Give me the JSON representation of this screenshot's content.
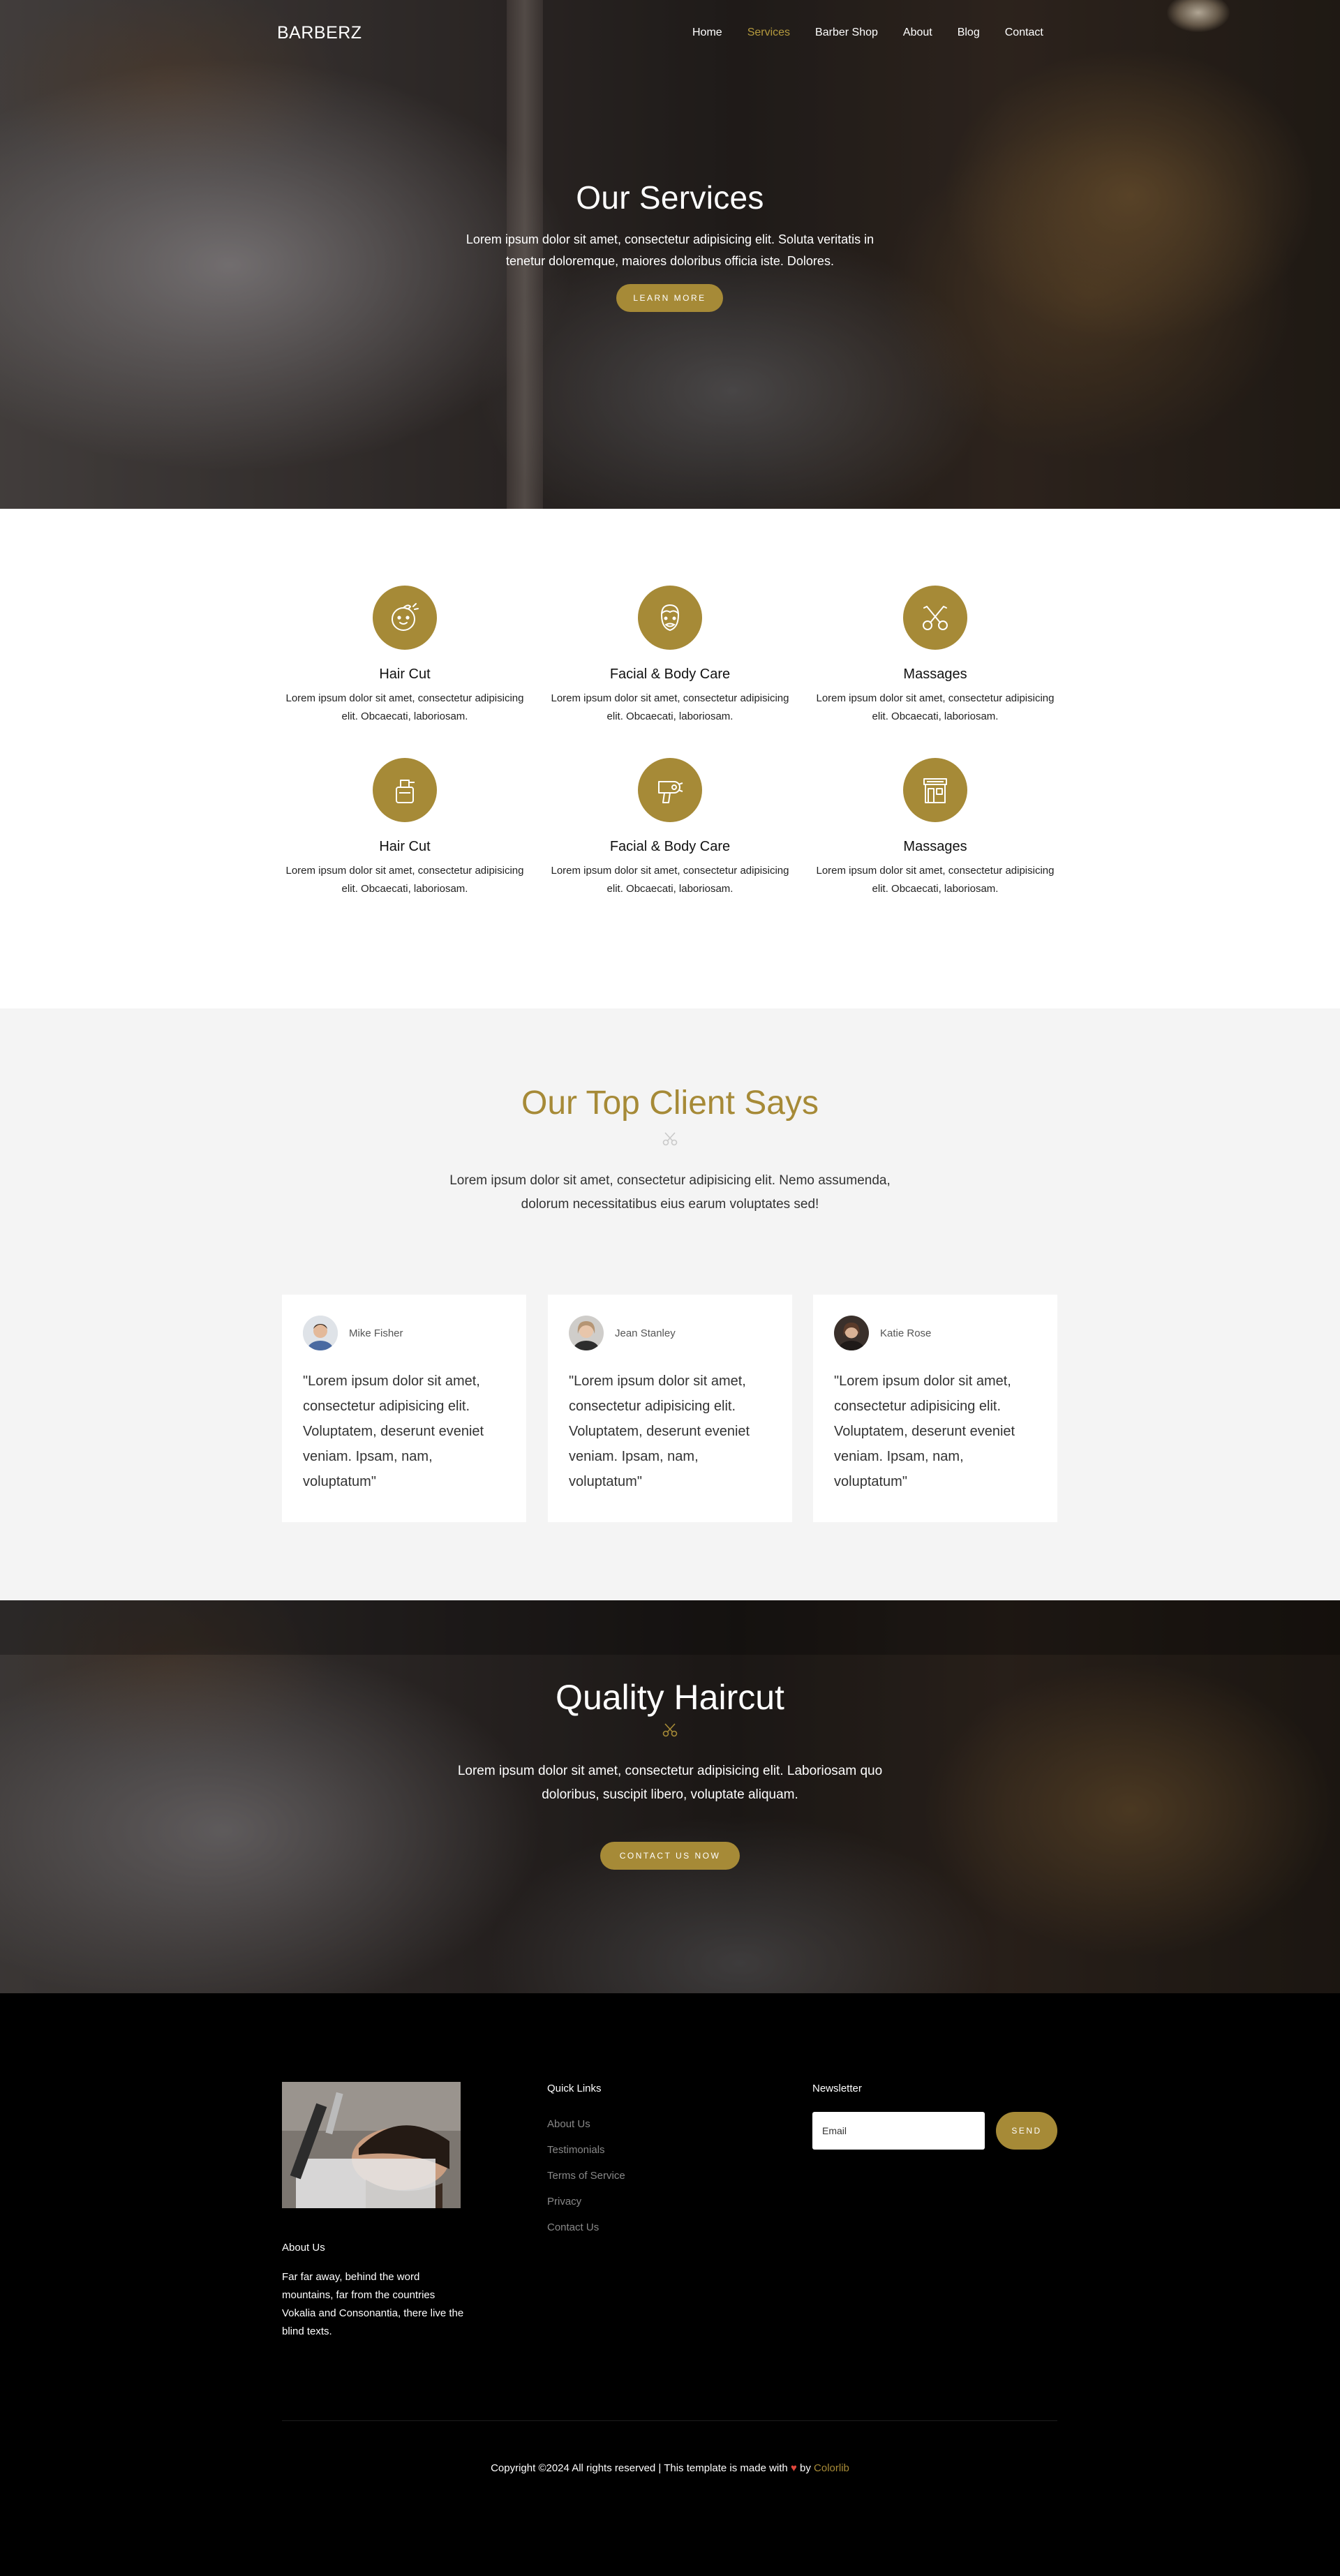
{
  "nav": {
    "brand": "BARBERZ",
    "links": [
      {
        "label": "Home",
        "active": false
      },
      {
        "label": "Services",
        "active": true
      },
      {
        "label": "Barber Shop",
        "active": false
      },
      {
        "label": "About",
        "active": false
      },
      {
        "label": "Blog",
        "active": false
      },
      {
        "label": "Contact",
        "active": false
      }
    ]
  },
  "hero": {
    "title": "Our Services",
    "text": "Lorem ipsum dolor sit amet, consectetur adipisicing elit. Soluta veritatis in tenetur doloremque, maiores doloribus officia iste. Dolores.",
    "button": "Learn More"
  },
  "services": [
    {
      "icon": "baby-face-icon",
      "title": "Hair Cut",
      "text": "Lorem ipsum dolor sit amet, consectetur adipisicing elit. Obcaecati, laboriosam."
    },
    {
      "icon": "man-face-icon",
      "title": "Facial & Body Care",
      "text": "Lorem ipsum dolor sit amet, consectetur adipisicing elit. Obcaecati, laboriosam."
    },
    {
      "icon": "scissors-icon",
      "title": "Massages",
      "text": "Lorem ipsum dolor sit amet, consectetur adipisicing elit. Obcaecati, laboriosam."
    },
    {
      "icon": "spray-bottle-icon",
      "title": "Hair Cut",
      "text": "Lorem ipsum dolor sit amet, consectetur adipisicing elit. Obcaecati, laboriosam."
    },
    {
      "icon": "hair-dryer-icon",
      "title": "Facial & Body Care",
      "text": "Lorem ipsum dolor sit amet, consectetur adipisicing elit. Obcaecati, laboriosam."
    },
    {
      "icon": "barber-shop-icon",
      "title": "Massages",
      "text": "Lorem ipsum dolor sit amet, consectetur adipisicing elit. Obcaecati, laboriosam."
    }
  ],
  "testimonials": {
    "title": "Our Top Client Says",
    "text": "Lorem ipsum dolor sit amet, consectetur adipisicing elit. Nemo assumenda, dolorum necessitatibus eius earum voluptates sed!",
    "items": [
      {
        "name": "Mike Fisher",
        "quote": "\"Lorem ipsum dolor sit amet, consectetur adipisicing elit. Voluptatem, deserunt eveniet veniam. Ipsam, nam, voluptatum\""
      },
      {
        "name": "Jean Stanley",
        "quote": "\"Lorem ipsum dolor sit amet, consectetur adipisicing elit. Voluptatem, deserunt eveniet veniam. Ipsam, nam, voluptatum\""
      },
      {
        "name": "Katie Rose",
        "quote": "\"Lorem ipsum dolor sit amet, consectetur adipisicing elit. Voluptatem, deserunt eveniet veniam. Ipsam, nam, voluptatum\""
      }
    ]
  },
  "cta": {
    "title": "Quality Haircut",
    "text": "Lorem ipsum dolor sit amet, consectetur adipisicing elit. Laboriosam quo doloribus, suscipit libero, voluptate aliquam.",
    "button": "Contact Us Now"
  },
  "footer": {
    "about_heading": "About Us",
    "about_text": "Far far away, behind the word mountains, far from the countries Vokalia and Consonantia, there live the blind texts.",
    "links_heading": "Quick Links",
    "links": [
      "About Us",
      "Testimonials",
      "Terms of Service",
      "Privacy",
      "Contact Us"
    ],
    "newsletter_heading": "Newsletter",
    "email_placeholder": "Email",
    "send_label": "Send",
    "copyright_text": "Copyright ©2024 All rights reserved | This template is made with",
    "heart": "♥",
    "by": "by",
    "credit": "Colorlib"
  },
  "colors": {
    "accent": "#a68a37",
    "active_nav": "#b59a3e",
    "footer_bg": "#000000",
    "testimonials_bg": "#f4f4f4"
  }
}
